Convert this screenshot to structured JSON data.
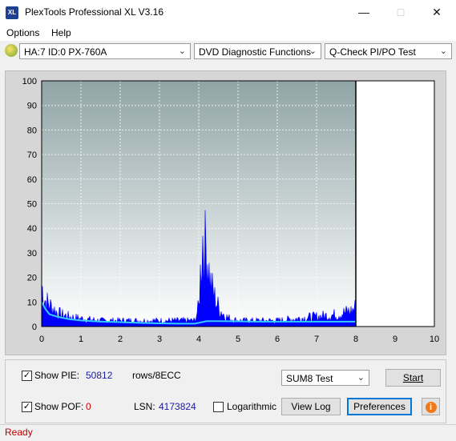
{
  "window": {
    "title": "PlexTools Professional XL V3.16",
    "icon_text": "XL"
  },
  "menu": {
    "options": "Options",
    "help": "Help"
  },
  "toolbar": {
    "drive": "HA:7 ID:0  PX-760A",
    "function": "DVD Diagnostic Functions",
    "test": "Q-Check PI/PO Test"
  },
  "chart_data": {
    "type": "area",
    "xlim": [
      0,
      10
    ],
    "ylim": [
      0,
      100
    ],
    "x_ticks": [
      "0",
      "1",
      "2",
      "3",
      "4",
      "5",
      "6",
      "7",
      "8",
      "9",
      "10"
    ],
    "y_ticks": [
      "0",
      "10",
      "20",
      "30",
      "40",
      "50",
      "60",
      "70",
      "80",
      "90",
      "100"
    ],
    "end_marker_x": 8,
    "grid": true,
    "series": [
      {
        "color": "#0000ff",
        "x": [
          0,
          0.05,
          0.1,
          0.2,
          0.3,
          0.4,
          0.5,
          0.7,
          1,
          1.5,
          2,
          2.5,
          3,
          3.5,
          3.9,
          4.0,
          4.05,
          4.1,
          4.15,
          4.2,
          4.25,
          4.3,
          4.4,
          4.5,
          4.6,
          4.7,
          4.8,
          5,
          5.5,
          6,
          6.5,
          7,
          7.5,
          7.9,
          8
        ],
        "y": [
          21,
          16,
          13,
          11,
          9,
          7,
          6,
          5,
          4,
          3,
          3,
          3,
          3,
          3,
          3,
          10,
          30,
          45,
          38,
          42,
          30,
          22,
          15,
          10,
          7,
          5,
          4,
          3,
          3,
          3,
          4,
          5,
          6,
          8,
          10
        ]
      },
      {
        "color": "#33ccff",
        "x": [
          0,
          0.1,
          0.2,
          0.4,
          0.7,
          1,
          1.5,
          2,
          2.5,
          3,
          3.5,
          3.9,
          4.0,
          4.2,
          4.5,
          5,
          5.5,
          6,
          6.5,
          7,
          7.5,
          8
        ],
        "y": [
          10,
          7,
          5,
          4,
          3,
          2.5,
          2,
          1.8,
          1.5,
          1.3,
          1.2,
          1.2,
          1.5,
          2.2,
          2.2,
          2.1,
          2.0,
          2.0,
          2.0,
          2.0,
          2.0,
          2.0
        ]
      }
    ]
  },
  "panel": {
    "show_pie_label": "Show PIE:",
    "pie_value": "50812",
    "pie_unit": "rows/8ECC",
    "show_pof_label": "Show POF:",
    "pof_value": "0",
    "lsn_label": "LSN:",
    "lsn_value": "4173824",
    "logarithmic_label": "Logarithmic",
    "sum8": "SUM8 Test",
    "start": "Start",
    "view_log": "View Log",
    "preferences": "Preferences",
    "info_icon_text": "i",
    "check_mark": "✓"
  },
  "status": {
    "text": "Ready"
  },
  "colors": {
    "pie_value": "#1a1aa0",
    "pof_value": "#cc0000",
    "status": "#c00000"
  }
}
